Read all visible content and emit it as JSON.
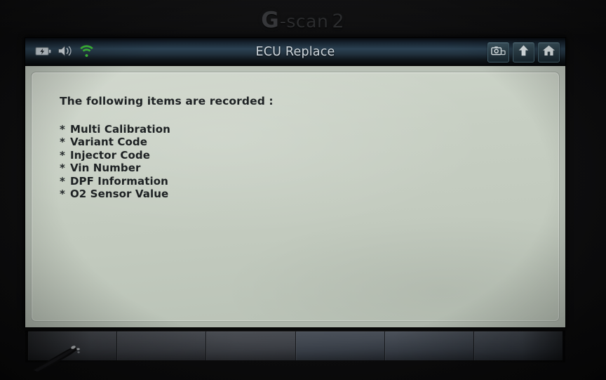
{
  "brand": {
    "logo_g": "G",
    "logo_scan": "-scan",
    "logo_model": "2",
    "full_text": "G-scan 2"
  },
  "titlebar": {
    "title": "ECU Replace",
    "status_icons": [
      {
        "name": "battery-charging-icon",
        "label": "Battery charging"
      },
      {
        "name": "speaker-volume-icon",
        "label": "Volume"
      },
      {
        "name": "wifi-icon",
        "label": "Wi-Fi connected",
        "color": "#3fc03a"
      }
    ],
    "tool_icons": [
      {
        "name": "screenshot-camera-icon",
        "label": "Capture screenshot"
      },
      {
        "name": "arrow-up-icon",
        "label": "Back / Up"
      },
      {
        "name": "home-icon",
        "label": "Home"
      }
    ],
    "colors": {
      "bar_top": "#07090d",
      "bar_mid": "#2b4152",
      "bar_bottom": "#05070a",
      "title_text": "#ced6dc"
    }
  },
  "content": {
    "intro": "The following items are recorded :",
    "bullet_glyph": "*",
    "items": [
      {
        "label": "Multi Calibration"
      },
      {
        "label": "Variant Code"
      },
      {
        "label": "Injector Code"
      },
      {
        "label": "Vin Number"
      },
      {
        "label": "DPF Information"
      },
      {
        "label": "O2 Sensor Value"
      }
    ],
    "colors": {
      "panel_bg": "#c7cfc3",
      "text": "#1d2123"
    }
  },
  "softkeys": {
    "count": 6,
    "keys": [
      {
        "label": ""
      },
      {
        "label": ""
      },
      {
        "label": ""
      },
      {
        "label": ""
      },
      {
        "label": ""
      },
      {
        "label": ""
      }
    ]
  },
  "hardware": {
    "stylus_present": true,
    "stylus_label": "Stylus pen resting on first soft key"
  }
}
